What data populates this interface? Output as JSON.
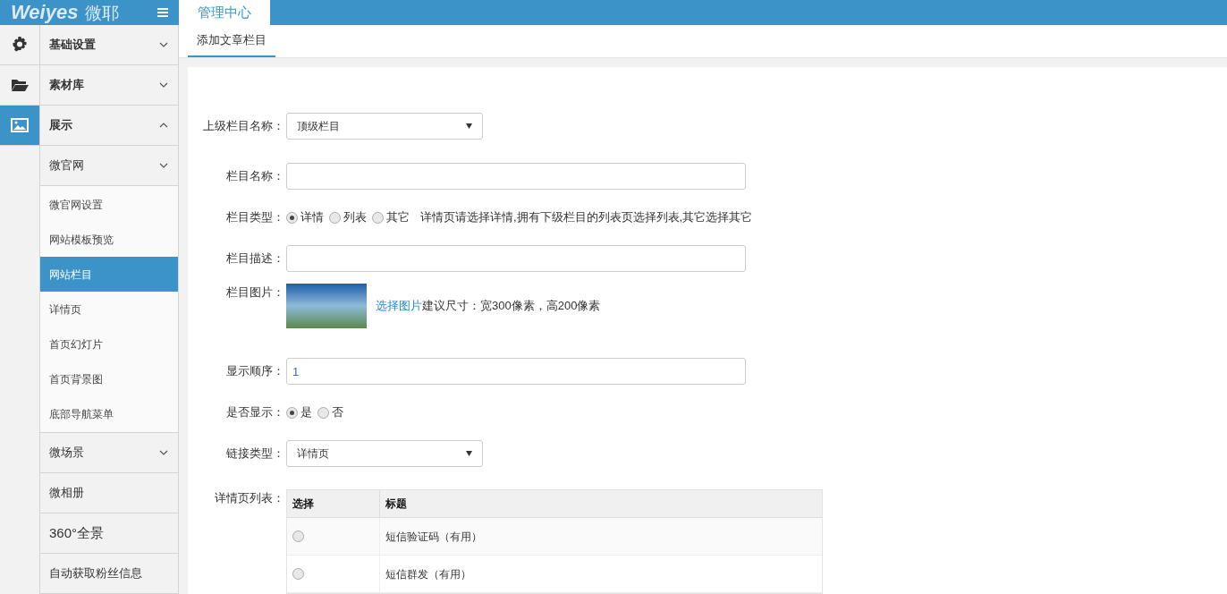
{
  "logo": {
    "latin": "Weiyes",
    "cn": "微耶"
  },
  "nav_icons": [
    {
      "kind": "gear",
      "selected": false
    },
    {
      "kind": "folder",
      "selected": false
    },
    {
      "kind": "image",
      "selected": true
    }
  ],
  "menu": [
    {
      "kind": "group",
      "label": "基础设置",
      "expanded": false
    },
    {
      "kind": "group",
      "label": "素材库",
      "expanded": false
    },
    {
      "kind": "group",
      "label": "展示",
      "expanded": true
    },
    {
      "kind": "subgroup",
      "label": "微官网",
      "expanded": false,
      "children": [
        {
          "label": "微官网设置",
          "selected": false
        },
        {
          "label": "网站模板预览",
          "selected": false
        },
        {
          "label": "网站栏目",
          "selected": true
        },
        {
          "label": "详情页",
          "selected": false
        },
        {
          "label": "首页幻灯片",
          "selected": false
        },
        {
          "label": "首页背景图",
          "selected": false
        },
        {
          "label": "底部导航菜单",
          "selected": false
        }
      ]
    },
    {
      "kind": "subgroup",
      "label": "微场景",
      "expanded": false
    },
    {
      "kind": "subgroup",
      "label": "微相册"
    },
    {
      "kind": "large",
      "label": "360°全景"
    },
    {
      "kind": "subgroup",
      "label": "自动获取粉丝信息"
    }
  ],
  "top_tab": "管理中心",
  "sub_tab": "添加文章栏目",
  "form": [
    {
      "kind": "select",
      "label": "上级栏目名称：",
      "value": "顶级栏目"
    },
    {
      "kind": "text",
      "label": "栏目名称："
    },
    {
      "kind": "radio",
      "label": "栏目类型：",
      "options": [
        {
          "label": "详情",
          "selected": true
        },
        {
          "label": "列表",
          "selected": false
        },
        {
          "label": "其它",
          "selected": false
        }
      ],
      "hint": "详情页请选择详情,拥有下级栏目的列表页选择列表,其它选择其它"
    },
    {
      "kind": "text",
      "label": "栏目描述："
    },
    {
      "kind": "image",
      "label": "栏目图片：",
      "link": "选择图片",
      "hint": "建议尺寸：宽300像素，高200像素"
    },
    {
      "kind": "text",
      "label": "显示顺序：",
      "value": "1"
    },
    {
      "kind": "radio",
      "label": "是否显示：",
      "options": [
        {
          "label": "是",
          "selected": true
        },
        {
          "label": "否",
          "selected": false
        }
      ]
    },
    {
      "kind": "select",
      "label": "链接类型：",
      "value": "详情页"
    },
    {
      "kind": "table",
      "label": "详情页列表：",
      "columns": [
        "选择",
        "标题"
      ],
      "rows": [
        {
          "title": "短信验证码（有用）",
          "selected": false
        },
        {
          "title": "短信群发（有用）",
          "selected": false
        }
      ]
    }
  ]
}
